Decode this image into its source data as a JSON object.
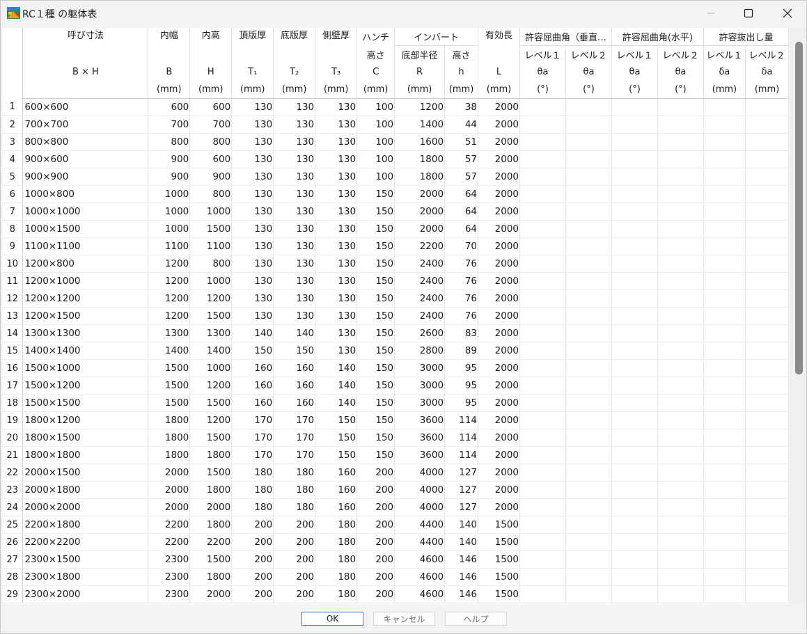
{
  "window": {
    "title": "RC１種 の躯体表"
  },
  "header": {
    "row1": [
      "呼び寸法",
      "内幅",
      "内高",
      "頂版厚",
      "底版厚",
      "側壁厚",
      "ハンチ",
      "インバート",
      "有効長",
      "許容屈曲角（垂直…",
      "許容屈曲角(水平)",
      "許容抜出し量"
    ],
    "row2": [
      "高さ",
      "底部半径",
      "高さ",
      "レベル１",
      "レベル２",
      "レベル１",
      "レベル２",
      "レベル１",
      "レベル２"
    ],
    "row3": [
      "B × H",
      "B",
      "H",
      "T₁",
      "T₂",
      "T₃",
      "C",
      "R",
      "h",
      "L",
      "θa",
      "θa",
      "θa",
      "θa",
      "δa",
      "δa"
    ],
    "row4": [
      "(mm)",
      "(mm)",
      "(mm)",
      "(mm)",
      "(mm)",
      "(mm)",
      "(mm)",
      "(mm)",
      "(mm)",
      "(°)",
      "(°)",
      "(°)",
      "(°)",
      "(mm)",
      "(mm)"
    ]
  },
  "rows": [
    [
      "1",
      "600×600",
      "600",
      "600",
      "130",
      "130",
      "130",
      "100",
      "1200",
      "38",
      "2000"
    ],
    [
      "2",
      "700×700",
      "700",
      "700",
      "130",
      "130",
      "130",
      "100",
      "1400",
      "44",
      "2000"
    ],
    [
      "3",
      "800×800",
      "800",
      "800",
      "130",
      "130",
      "130",
      "100",
      "1600",
      "51",
      "2000"
    ],
    [
      "4",
      "900×600",
      "900",
      "600",
      "130",
      "130",
      "130",
      "100",
      "1800",
      "57",
      "2000"
    ],
    [
      "5",
      "900×900",
      "900",
      "900",
      "130",
      "130",
      "130",
      "100",
      "1800",
      "57",
      "2000"
    ],
    [
      "6",
      "1000×800",
      "1000",
      "800",
      "130",
      "130",
      "130",
      "150",
      "2000",
      "64",
      "2000"
    ],
    [
      "7",
      "1000×1000",
      "1000",
      "1000",
      "130",
      "130",
      "130",
      "150",
      "2000",
      "64",
      "2000"
    ],
    [
      "8",
      "1000×1500",
      "1000",
      "1500",
      "130",
      "130",
      "130",
      "150",
      "2000",
      "64",
      "2000"
    ],
    [
      "9",
      "1100×1100",
      "1100",
      "1100",
      "130",
      "130",
      "130",
      "150",
      "2200",
      "70",
      "2000"
    ],
    [
      "10",
      "1200×800",
      "1200",
      "800",
      "130",
      "130",
      "130",
      "150",
      "2400",
      "76",
      "2000"
    ],
    [
      "11",
      "1200×1000",
      "1200",
      "1000",
      "130",
      "130",
      "130",
      "150",
      "2400",
      "76",
      "2000"
    ],
    [
      "12",
      "1200×1200",
      "1200",
      "1200",
      "130",
      "130",
      "130",
      "150",
      "2400",
      "76",
      "2000"
    ],
    [
      "13",
      "1200×1500",
      "1200",
      "1500",
      "130",
      "130",
      "130",
      "150",
      "2400",
      "76",
      "2000"
    ],
    [
      "14",
      "1300×1300",
      "1300",
      "1300",
      "140",
      "140",
      "130",
      "150",
      "2600",
      "83",
      "2000"
    ],
    [
      "15",
      "1400×1400",
      "1400",
      "1400",
      "150",
      "150",
      "130",
      "150",
      "2800",
      "89",
      "2000"
    ],
    [
      "16",
      "1500×1000",
      "1500",
      "1000",
      "160",
      "160",
      "140",
      "150",
      "3000",
      "95",
      "2000"
    ],
    [
      "17",
      "1500×1200",
      "1500",
      "1200",
      "160",
      "160",
      "140",
      "150",
      "3000",
      "95",
      "2000"
    ],
    [
      "18",
      "1500×1500",
      "1500",
      "1500",
      "160",
      "160",
      "140",
      "150",
      "3000",
      "95",
      "2000"
    ],
    [
      "19",
      "1800×1200",
      "1800",
      "1200",
      "170",
      "170",
      "150",
      "150",
      "3600",
      "114",
      "2000"
    ],
    [
      "20",
      "1800×1500",
      "1800",
      "1500",
      "170",
      "170",
      "150",
      "150",
      "3600",
      "114",
      "2000"
    ],
    [
      "21",
      "1800×1800",
      "1800",
      "1800",
      "170",
      "170",
      "150",
      "150",
      "3600",
      "114",
      "2000"
    ],
    [
      "22",
      "2000×1500",
      "2000",
      "1500",
      "180",
      "180",
      "160",
      "200",
      "4000",
      "127",
      "2000"
    ],
    [
      "23",
      "2000×1800",
      "2000",
      "1800",
      "180",
      "180",
      "160",
      "200",
      "4000",
      "127",
      "2000"
    ],
    [
      "24",
      "2000×2000",
      "2000",
      "2000",
      "180",
      "180",
      "160",
      "200",
      "4000",
      "127",
      "2000"
    ],
    [
      "25",
      "2200×1800",
      "2200",
      "1800",
      "200",
      "200",
      "180",
      "200",
      "4400",
      "140",
      "1500"
    ],
    [
      "26",
      "2200×2200",
      "2200",
      "2200",
      "200",
      "200",
      "180",
      "200",
      "4400",
      "140",
      "1500"
    ],
    [
      "27",
      "2300×1500",
      "2300",
      "1500",
      "200",
      "200",
      "180",
      "200",
      "4600",
      "146",
      "1500"
    ],
    [
      "28",
      "2300×1800",
      "2300",
      "1800",
      "200",
      "200",
      "180",
      "200",
      "4600",
      "146",
      "1500"
    ],
    [
      "29",
      "2300×2000",
      "2300",
      "2000",
      "200",
      "200",
      "180",
      "200",
      "4600",
      "146",
      "1500"
    ]
  ],
  "buttons": {
    "ok": "OK",
    "cancel": "キャンセル",
    "help": "ヘルプ"
  },
  "icons": {
    "app": "rc-table-app-icon",
    "minimize": "minimize-icon",
    "maximize": "maximize-icon",
    "close": "close-icon"
  },
  "colors": {
    "ok_border": "#3b79d8",
    "scroll_thumb": "#8a8a8a"
  }
}
